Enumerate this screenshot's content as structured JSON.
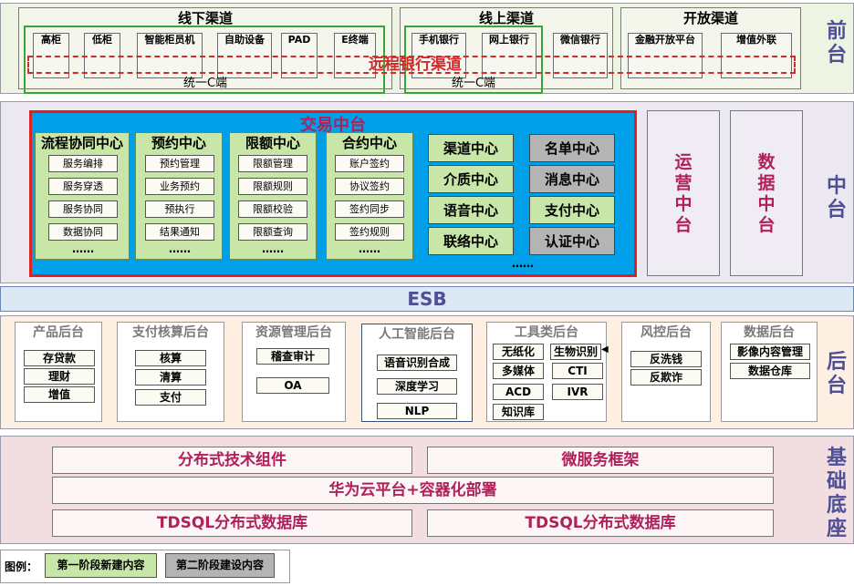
{
  "layers": {
    "front": "前台",
    "middle": "中台",
    "back": "后台",
    "base": "基础底座"
  },
  "front": {
    "offline": {
      "title": "线下渠道",
      "items": [
        "高柜",
        "低柜",
        "智能柜员机",
        "自助设备",
        "PAD",
        "E终端"
      ],
      "unified": "统一C端"
    },
    "online": {
      "title": "线上渠道",
      "items": [
        "手机银行",
        "网上银行",
        "微信银行"
      ],
      "unified": "统一C端"
    },
    "open": {
      "title": "开放渠道",
      "items": [
        "金融开放平台",
        "增值外联"
      ]
    },
    "remote": "远程银行渠道"
  },
  "middle": {
    "trade_title": "交易中台",
    "centers": [
      {
        "title": "流程协同中心",
        "items": [
          "服务编排",
          "服务穿透",
          "服务协同",
          "数据协同"
        ],
        "more": "……"
      },
      {
        "title": "预约中心",
        "items": [
          "预约管理",
          "业务预约",
          "预执行",
          "结果通知"
        ],
        "more": "……"
      },
      {
        "title": "限额中心",
        "items": [
          "限额管理",
          "限额规则",
          "限额校验",
          "限额查询"
        ],
        "more": "……"
      },
      {
        "title": "合约中心",
        "items": [
          "账户签约",
          "协议签约",
          "签约同步",
          "签约规则"
        ],
        "more": "……"
      }
    ],
    "grid": [
      [
        "渠道中心",
        "名单中心"
      ],
      [
        "介质中心",
        "消息中心"
      ],
      [
        "语音中心",
        "支付中心"
      ],
      [
        "联络中心",
        "认证中心"
      ]
    ],
    "grid_more": "……",
    "ops": "运营中台",
    "data": "数据中台"
  },
  "esb": "ESB",
  "back": {
    "groups": [
      {
        "title": "产品后台",
        "items": [
          "存贷款",
          "理财",
          "增值"
        ]
      },
      {
        "title": "支付核算后台",
        "items": [
          "核算",
          "清算",
          "支付"
        ]
      },
      {
        "title": "资源管理后台",
        "items": [
          "稽查审计",
          "OA"
        ]
      },
      {
        "title": "人工智能后台",
        "items": [
          "语音识别合成",
          "深度学习",
          "NLP"
        ]
      },
      {
        "title": "工具类后台",
        "items": [
          "无纸化",
          "生物识别",
          "多媒体",
          "CTI",
          "ACD",
          "IVR",
          "知识库"
        ]
      },
      {
        "title": "风控后台",
        "items": [
          "反洗钱",
          "反欺诈"
        ]
      },
      {
        "title": "数据后台",
        "items": [
          "影像内容管理",
          "数据仓库"
        ]
      }
    ]
  },
  "base": {
    "row1": [
      "分布式技术组件",
      "微服务框架"
    ],
    "row2": "华为云平台+容器化部署",
    "row3": [
      "TDSQL分布式数据库",
      "TDSQL分布式数据库"
    ]
  },
  "legend": {
    "label": "图例：",
    "phase1": "第一阶段新建内容",
    "phase2": "第二阶段建设内容"
  },
  "colors": {
    "front_bg": "#eef4e2",
    "middle_bg": "#ece8f2",
    "trade_bg": "#00a0e8",
    "trade_border": "#e0201e",
    "esb_bg": "#dce8f4",
    "back_bg": "#fdf0e2",
    "base_bg": "#f2dde0",
    "phase1": "#c7e6a7",
    "phase2": "#b4b4b4"
  }
}
